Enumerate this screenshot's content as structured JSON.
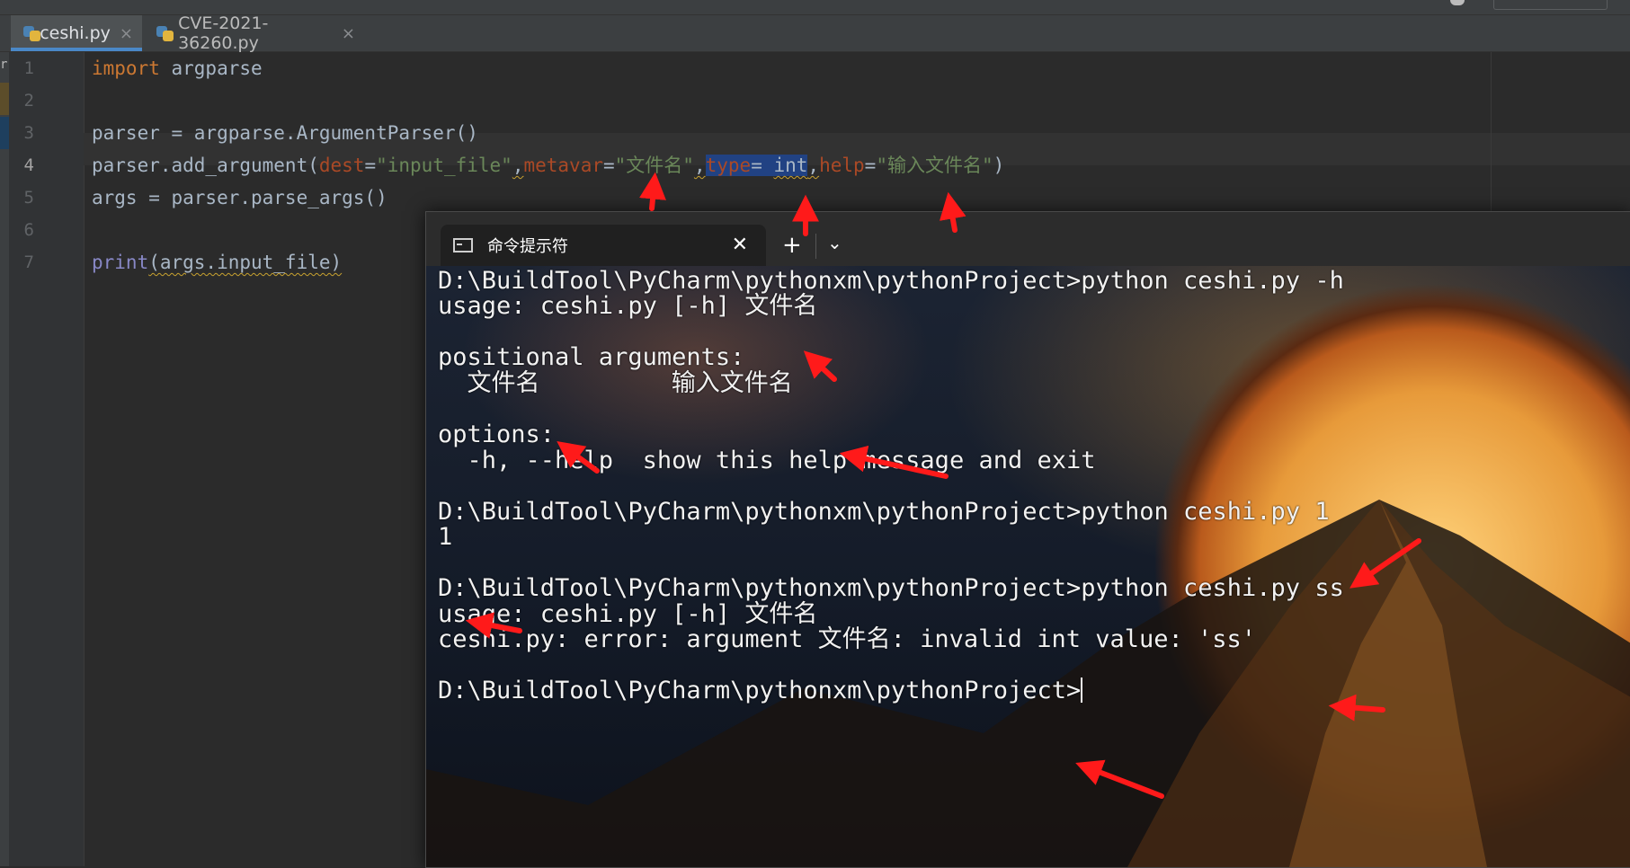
{
  "tabs": [
    {
      "label": "ceshi.py",
      "active": true
    },
    {
      "label": "CVE-2021-36260.py",
      "active": false
    }
  ],
  "editor": {
    "line_numbers": [
      "1",
      "2",
      "3",
      "4",
      "5",
      "6",
      "7"
    ],
    "current_line": 4,
    "lines": {
      "l1_kw": "import",
      "l1_rest": " argparse",
      "l3": "parser = argparse.ArgumentParser()",
      "l4_a": "parser.add_argument(",
      "l4_dest": "dest",
      "l4_eq1": "=",
      "l4_s1": "\"input_file\"",
      "l4_comma1": ",",
      "l4_metavar": "metavar",
      "l4_eq2": "=",
      "l4_s2": "\"文件名\"",
      "l4_comma2": ",",
      "l4_type": "type",
      "l4_eq3": "= ",
      "l4_int": "int",
      "l4_comma3": ",",
      "l4_help": "help",
      "l4_eq4": "=",
      "l4_s3": "\"输入文件名\"",
      "l4_close": ")",
      "l5": "args = parser.parse_args()",
      "l7_fn": "print",
      "l7_rest": "(args.input_file)"
    }
  },
  "terminal": {
    "tab_title": "命令提示符",
    "close_glyph": "✕",
    "new_tab_glyph": "+",
    "dropdown_glyph": "⌄",
    "lines": [
      "D:\\BuildTool\\PyCharm\\pythonxm\\pythonProject>python ceshi.py -h",
      "usage: ceshi.py [-h] 文件名",
      "",
      "positional arguments:",
      "  文件名         输入文件名",
      "",
      "options:",
      "  -h, --help  show this help message and exit",
      "",
      "D:\\BuildTool\\PyCharm\\pythonxm\\pythonProject>python ceshi.py 1",
      "1",
      "",
      "D:\\BuildTool\\PyCharm\\pythonxm\\pythonProject>python ceshi.py ss",
      "usage: ceshi.py [-h] 文件名",
      "ceshi.py: error: argument 文件名: invalid int value: 'ss'",
      "",
      "D:\\BuildTool\\PyCharm\\pythonxm\\pythonProject>"
    ]
  },
  "colors": {
    "editor_bg": "#2b2b2b",
    "keyword": "#cc7832",
    "string": "#6a8759",
    "param": "#aa4926",
    "selection": "#214283",
    "annotation_arrow": "#ff1a1a"
  }
}
